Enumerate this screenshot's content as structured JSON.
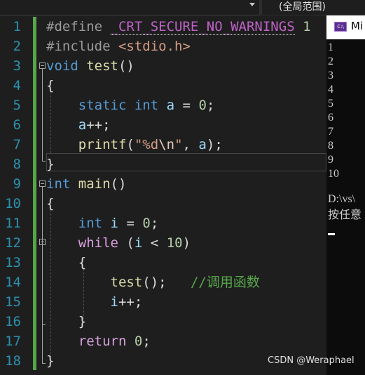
{
  "toolbar": {
    "scope_label": "(全局范围)"
  },
  "editor": {
    "line_numbers": [
      "1",
      "2",
      "3",
      "4",
      "5",
      "6",
      "7",
      "8",
      "9",
      "10",
      "11",
      "12",
      "13",
      "14",
      "15",
      "16",
      "17",
      "18"
    ],
    "lines": {
      "l1": {
        "directive": "#define",
        "macro": "_CRT_SECURE_NO_WARNINGS",
        "value": "1"
      },
      "l2": {
        "directive": "#include",
        "header": "<stdio.h>"
      },
      "l3": {
        "type": "void",
        "name": "test",
        "punct": "()"
      },
      "l4": {
        "brace": "{"
      },
      "l5": {
        "kw1": "static",
        "kw2": "int",
        "var": "a",
        "op": "=",
        "num": "0",
        "semi": ";"
      },
      "l6": {
        "var": "a",
        "rest": "++;"
      },
      "l7": {
        "fn": "printf",
        "open": "(",
        "str1": "\"%d",
        "esc": "\\n",
        "str2": "\"",
        "sep": ", ",
        "arg": "a",
        "close": ");"
      },
      "l8": {
        "brace": "}"
      },
      "l9": {
        "type": "int",
        "name": "main",
        "punct": "()"
      },
      "l10": {
        "brace": "{"
      },
      "l11": {
        "kw": "int",
        "var": "i",
        "op": "=",
        "num": "0",
        "semi": ";"
      },
      "l12": {
        "kw": "while",
        "open": "(",
        "var": "i",
        "op": "<",
        "num": "10",
        "close": ")"
      },
      "l13": {
        "brace": "{"
      },
      "l14": {
        "fn": "test",
        "rest": "();",
        "comment": "//调用函数"
      },
      "l15": {
        "var": "i",
        "rest": "++;"
      },
      "l16": {
        "brace": "}"
      },
      "l17": {
        "kw": "return",
        "num": "0",
        "semi": ";"
      },
      "l18": {
        "brace": "}"
      }
    }
  },
  "console": {
    "title": "Mi",
    "icon_text": "C:\\",
    "output": [
      "1",
      "2",
      "3",
      "4",
      "5",
      "6",
      "7",
      "8",
      "9",
      "10"
    ],
    "path_fragment": "D:\\vs\\",
    "prompt_fragment": "按任意"
  },
  "watermark": "CSDN @Weraphael",
  "colors": {
    "editor_bg": "#1e1e1e",
    "line_number": "#2b91af",
    "keyword": "#569cd6",
    "macro": "#bd63c5",
    "string": "#d69d85",
    "number": "#b5cea8",
    "variable": "#9cdcfe",
    "function": "#dcdcaa",
    "comment": "#57a64a",
    "change_bar": "#57a64a",
    "console_bg": "#0c0c0c"
  }
}
